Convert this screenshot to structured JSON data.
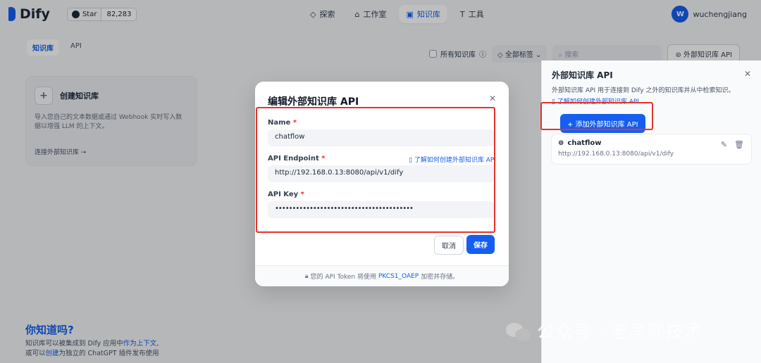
{
  "app": {
    "name": "Dify"
  },
  "github": {
    "star_label": "Star",
    "star_count": "82,283"
  },
  "nav": [
    {
      "icon": "◇",
      "label": "探索",
      "active": false
    },
    {
      "icon": "⌂",
      "label": "工作室",
      "active": false
    },
    {
      "icon": "▣",
      "label": "知识库",
      "active": true
    },
    {
      "icon": "T",
      "label": "工具",
      "active": false
    }
  ],
  "user": {
    "initial": "W",
    "name": "wuchengjiang"
  },
  "tabs": {
    "dataset": "知识库",
    "api": "API"
  },
  "filters": {
    "all_label": "所有知识库",
    "tags_label": "全部标签",
    "search_placeholder": "搜索",
    "external_api_button": "外部知识库 API"
  },
  "create_card": {
    "title": "创建知识库",
    "description": "导入您自己的文本数据或通过 Webhook 实时写入数据以增强 LLM 的上下文。",
    "connect_link": "连接外部知识库 →"
  },
  "did_you_know": {
    "title": "你知道吗?",
    "line1_prefix": "知识库可以被集成到 Dify 应用中",
    "line1_link": "作为上下文",
    "line1_suffix": ",",
    "line2_prefix": "或可以",
    "line2_link": "创建",
    "line2_suffix": "为独立的 ChatGPT 插件发布使用"
  },
  "right_panel": {
    "title": "外部知识库 API",
    "description": "外部知识库 API 用于连接到 Dify 之外的知识库并从中检索知识。",
    "learn_link": "了解如何创建外部知识库 API",
    "add_button": "+ 添加外部知识库 API",
    "items": [
      {
        "name": "chatflow",
        "url": "http://192.168.0.13:8080/api/v1/dify"
      }
    ]
  },
  "modal": {
    "title": "编辑外部知识库 API",
    "name_label": "Name",
    "name_value": "chatflow",
    "endpoint_label": "API Endpoint",
    "endpoint_link": "了解如何创建外部知识库 API",
    "endpoint_value": "http://192.168.0.13:8080/api/v1/dify",
    "key_label": "API Key",
    "key_value": "••••••••••••••••••••••••••••••••••••••••",
    "required_mark": "*",
    "cancel": "取消",
    "save": "保存",
    "footer_prefix": "您的 API Token 将使用",
    "footer_link": "PKCS1_OAEP",
    "footer_suffix": "加密并存储。"
  },
  "watermark": {
    "text": "公众号 · 老吴聊技术"
  },
  "colors": {
    "accent": "#155eef",
    "highlight": "#e5322d"
  }
}
